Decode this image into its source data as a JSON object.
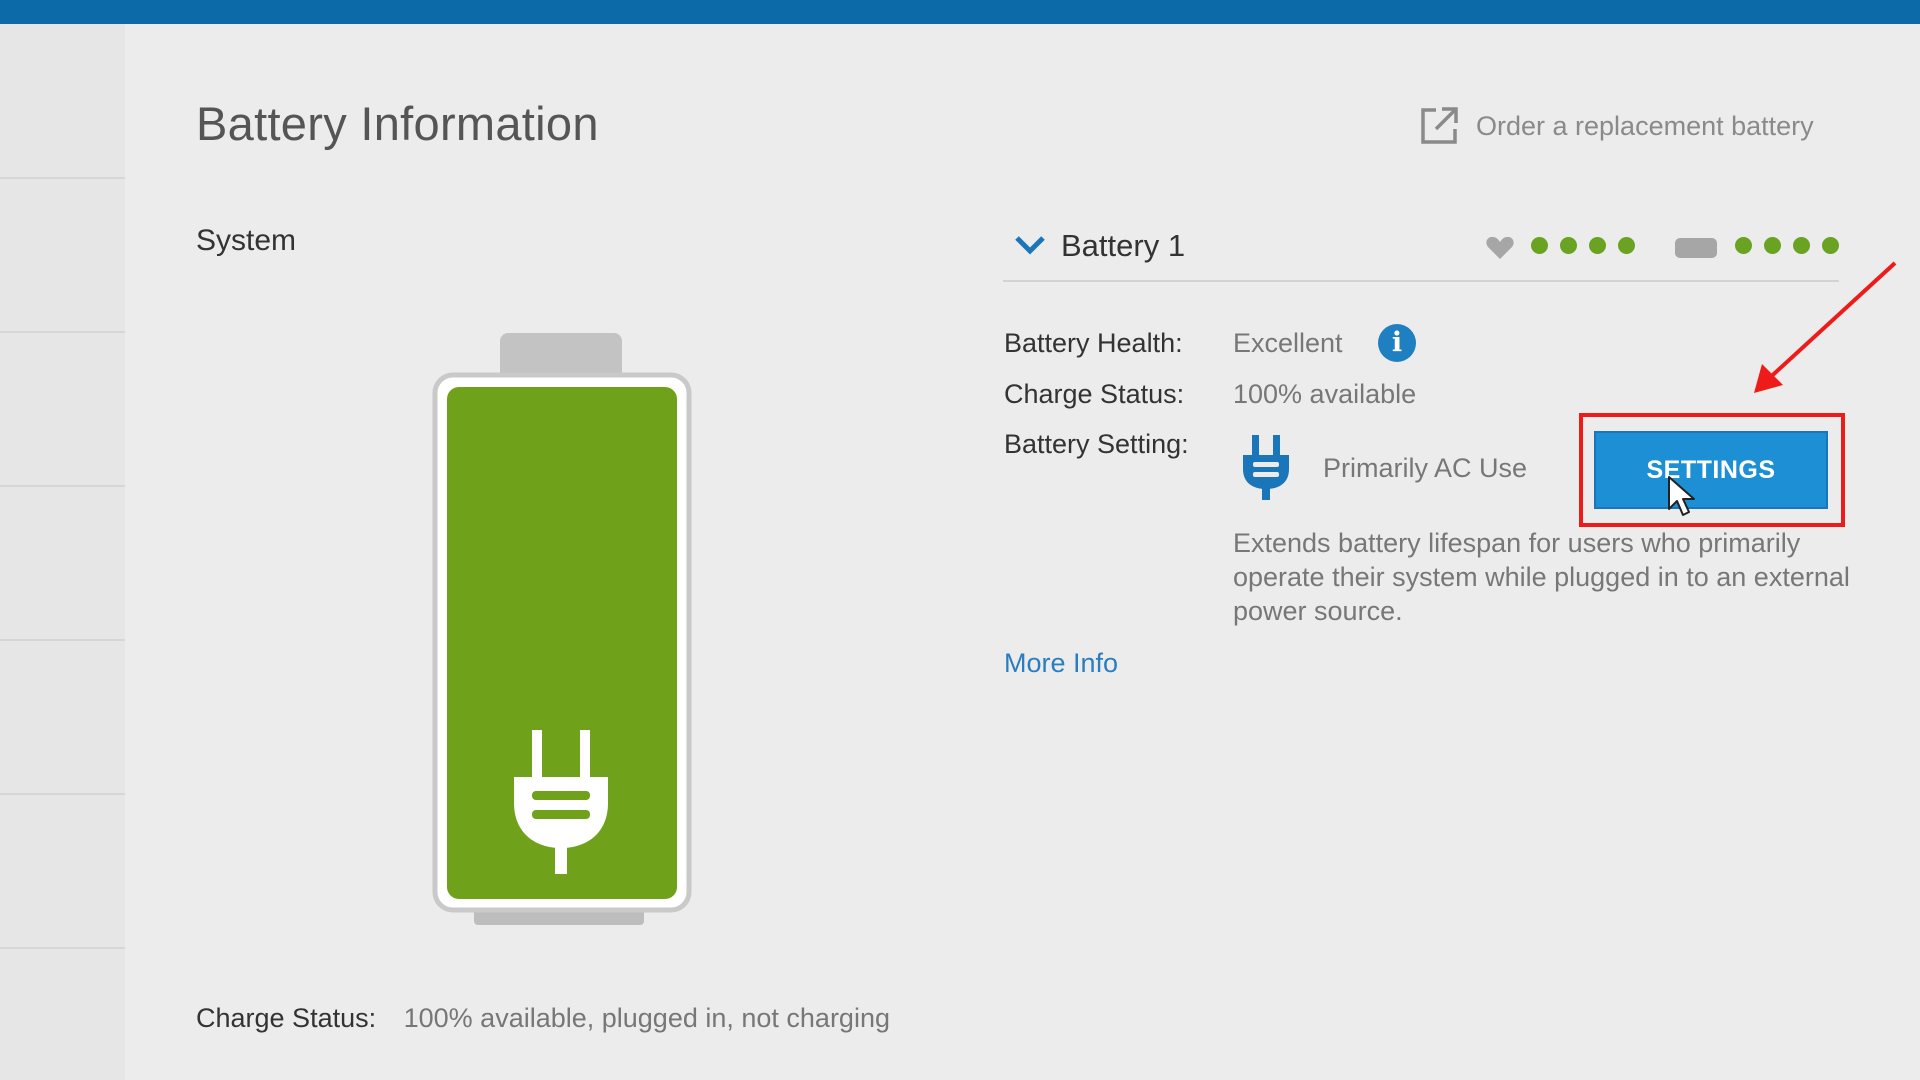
{
  "header": {
    "page_title": "Battery Information",
    "order_link_label": "Order a replacement battery"
  },
  "system": {
    "label": "System",
    "charge_status_label": "Charge Status:",
    "charge_status_value": "100% available, plugged in, not charging",
    "charge_level": 1.0,
    "fill_color": "#6fa11a"
  },
  "battery_panel": {
    "title": "Battery 1",
    "health_rating": 4,
    "charge_rating": 4,
    "rating_color": "#6aa221",
    "fields": {
      "health_label": "Battery Health:",
      "health_value": "Excellent",
      "charge_label": "Charge Status:",
      "charge_value": "100% available",
      "setting_label": "Battery Setting:",
      "setting_value": "Primarily AC Use"
    },
    "settings_button_label": "SETTINGS",
    "description": "Extends battery lifespan for users who primarily operate their system while plugged in to an external power source.",
    "more_info_label": "More Info"
  },
  "annotations": {
    "highlight_color": "#ee1b1b"
  }
}
